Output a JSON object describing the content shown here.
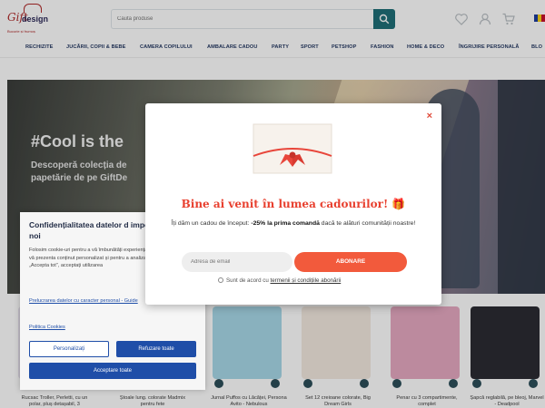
{
  "brand": {
    "logo_a": "Gift",
    "logo_b": "design",
    "tagline": "Bucurie și frumoș"
  },
  "search": {
    "placeholder": "Caută produse"
  },
  "nav": [
    "RECHIZITE",
    "JUCĂRII, COPII & BEBE",
    "CAMERA COPILULUI",
    "AMBALARE CADOU",
    "PARTY",
    "SPORT",
    "PETSHOP",
    "FASHION",
    "HOME & DECO",
    "ÎNGRIJIRE PERSONALĂ",
    "BLO"
  ],
  "hero": {
    "title": "#Cool is the",
    "subtitle": "Descoperă colecția de papetărie de pe GiftDe"
  },
  "products": [
    {
      "name": "Rucsac Troller, Perletti, cu un polar, pluș detașabil, 3",
      "color": "#e9e4f1"
    },
    {
      "name": "Ștoale lung. colorate Madmix pentru fete",
      "color": "#dfe9f3"
    },
    {
      "name": "Jurnal Puffos cu Lăcăței, Persona Avito - Nebulous",
      "color": "#a8d8e8"
    },
    {
      "name": "Set 12 creioane colorate, Big Dream Girls",
      "color": "#f3e9e0"
    },
    {
      "name": "Penar cu 3 compartimente, complet",
      "color": "#e6a9c1"
    },
    {
      "name": "Șapcă reglabilă, pe bleoj, Marvel - Deadpool",
      "color": "#2b2b33"
    }
  ],
  "cookie": {
    "title": "Confidențialitatea datelor d importantă pentru noi",
    "body": "Folosim cookie-uri pentru a vă îmbunătăți experiența de navigare, pentru a vă prezenta conținut personalizat și pentru a analiza traficul. Făcând clic pe „Accepta tot”, acceptați utilizarea",
    "link1": "Prelucrarea datelor cu caracter personal - Guide",
    "link2": "Politica Cookies",
    "btn_personalize": "Personalizați",
    "btn_refuse": "Refuzare toate",
    "btn_accept": "Acceptare toate"
  },
  "modal": {
    "close": "×",
    "title": "Bine ai venit în lumea cadourilor! 🎁",
    "text_a": "Îți dăm un cadou de început: ",
    "text_bold": "-25% la prima comandă",
    "text_b": " dacă te alături comunității noastre!",
    "email_placeholder": "Adresă de email",
    "subscribe": "ABONARE",
    "agree_a": "Sunt de acord cu ",
    "agree_link": "termenii și condițiile abonării"
  },
  "colors": {
    "accent": "#f25a3c",
    "teal": "#1f6f78",
    "cookie_blue": "#1f4ea8",
    "title_red": "#e8402f"
  }
}
